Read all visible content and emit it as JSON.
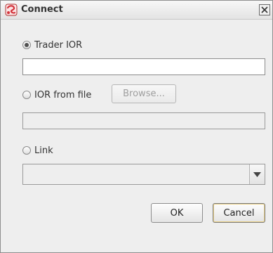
{
  "window": {
    "title": "Connect",
    "icon": "cyclone-app-icon"
  },
  "options": {
    "trader_ior": {
      "label": "Trader IOR",
      "selected": true,
      "value": ""
    },
    "ior_file": {
      "label": "IOR from file",
      "selected": false,
      "browse_label": "Browse...",
      "value": ""
    },
    "link": {
      "label": "Link",
      "selected": false,
      "value": ""
    }
  },
  "buttons": {
    "ok": "OK",
    "cancel": "Cancel"
  },
  "colors": {
    "focus_ring": "#e9d089",
    "window_bg": "#eeeeee",
    "app_icon": "#d3323a"
  }
}
